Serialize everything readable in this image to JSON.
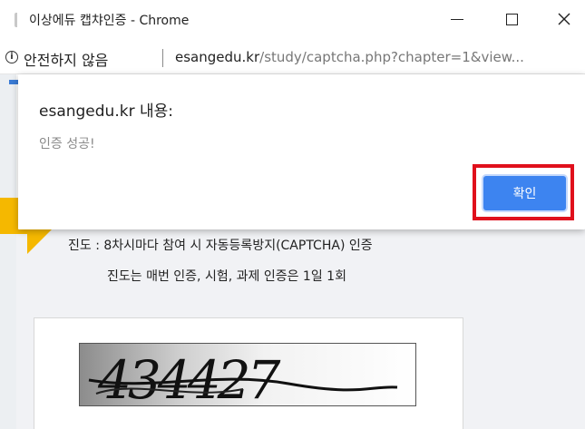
{
  "window": {
    "title": "이상에듀 캡챠인증 - Chrome"
  },
  "address_bar": {
    "security_label": "안전하지 않음",
    "url_host": "esangedu.kr",
    "url_path": "/study/captcha.php?chapter=1&view..."
  },
  "dialog": {
    "title": "esangedu.kr 내용:",
    "message": "인증 성공!",
    "ok_label": "확인"
  },
  "page": {
    "notice_line1": "진도 : 8차시마다 참여 시 자동등록방지(CAPTCHA) 인증",
    "notice_line2": "진도는 매번 인증, 시험, 과제 인증은 1일 1회",
    "captcha_text": "434427"
  },
  "colors": {
    "accent_button": "#3d84f0",
    "highlight": "#e0101c",
    "arrow": "#f5b800"
  },
  "icons": [
    "app-icon",
    "info-icon",
    "minimize-icon",
    "maximize-icon",
    "close-icon",
    "arrow-icon"
  ]
}
